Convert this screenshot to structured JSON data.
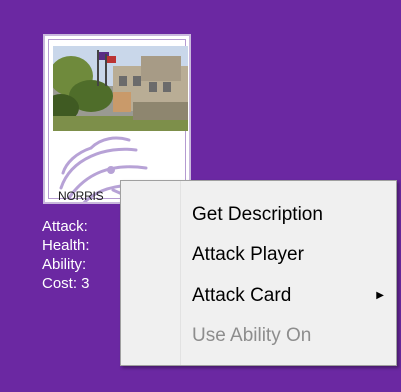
{
  "card": {
    "name": "NORRIS",
    "image": "building-photo",
    "logo": "wildcat-logo"
  },
  "stats": {
    "attack": "Attack:",
    "health": "Health:",
    "ability": "Ability:",
    "cost": "Cost: 3"
  },
  "context_menu": {
    "items": [
      {
        "label": "Get Description",
        "enabled": true
      },
      {
        "label": "Attack Player",
        "enabled": true
      },
      {
        "label": "Attack Card",
        "enabled": true,
        "has_submenu": true,
        "submenu_icon": "chevron-right-icon"
      },
      {
        "label": "Use Ability On",
        "enabled": false
      }
    ]
  },
  "colors": {
    "background": "#6b28a2",
    "menu_background": "#f0f0f0",
    "disabled_text": "#8d8d8d"
  }
}
